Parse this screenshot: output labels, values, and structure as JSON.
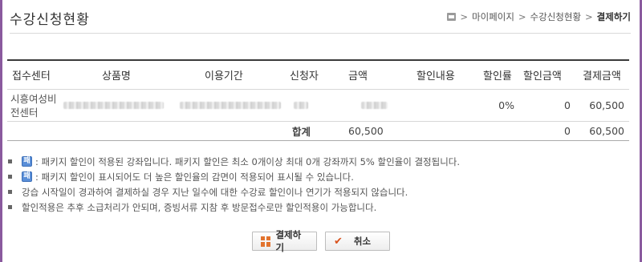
{
  "page": {
    "title": "수강신청현황",
    "breadcrumb": [
      "마이페이지",
      "수강신청현황",
      "결제하기"
    ]
  },
  "table": {
    "headers": [
      "접수센터",
      "상품명",
      "이용기간",
      "신청자",
      "금액",
      "할인내용",
      "할인률",
      "할인금액",
      "결제금액"
    ],
    "row": {
      "center_line1": "시흥여성비",
      "center_line2": "전센터",
      "discount_rate": "0%",
      "discount_amount": "0",
      "pay_amount": "60,500"
    },
    "total": {
      "label": "합계",
      "amount": "60,500",
      "discount_amount": "0",
      "pay_amount": "60,500"
    }
  },
  "notes": {
    "pkg_icon": "패",
    "items": [
      ": 패키지 할인이 적용된 강좌입니다. 패키지 할인은 최소 0개이상 최대 0개 강좌까지 5% 할인율이 결정됩니다.",
      ": 패키지 할인이 표시되어도 더 높은 할인율의 감면이 적용되어 표시될 수 있습니다.",
      "강습 시작일이 경과하여 결제하실 경우 지난 일수에 대한 수강료 할인이나 연기가 적용되지 않습니다.",
      "할인적용은 추후 소급처리가 안되며, 증빙서류 지참 후 방문접수로만 할인적용이 가능합니다."
    ]
  },
  "buttons": {
    "pay": "결제하기",
    "cancel": "취소"
  }
}
